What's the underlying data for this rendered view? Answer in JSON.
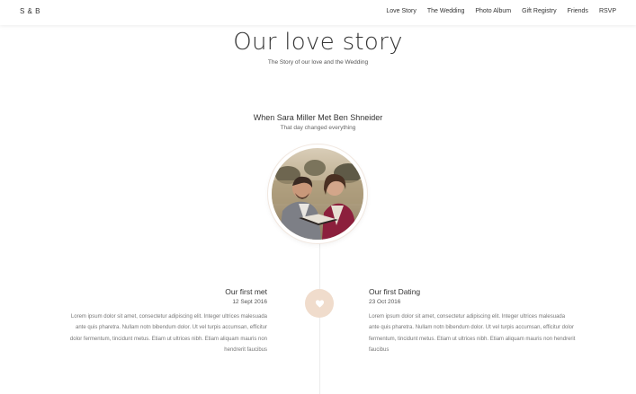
{
  "nav": {
    "brand": "S & B",
    "items": [
      "Love Story",
      "The Wedding",
      "Photo Album",
      "Gift Registry",
      "Friends",
      "RSVP"
    ]
  },
  "header": {
    "title": "Our love story",
    "subtitle": "The Story of our love and the Wedding"
  },
  "intro": {
    "heading": "When Sara Miller Met Ben Shneider",
    "subheading": "That day changed everything"
  },
  "timeline": {
    "badge_icon": "heart-icon",
    "events": [
      {
        "title": "Our first met",
        "date": "12 Sept 2016",
        "text": "Lorem ipsum dolor sit amet, consectetur adipiscing elit. Integer ultrices malesuada ante quis pharetra. Nullam notn bibendum dolor. Ut vel turpis accumsan, efficitur dolor fermentum, tincidunt metus. Etiam ut ultrices nibh. Etiam aliquam mauris non hendrerit faucibus"
      },
      {
        "title": "Our first Dating",
        "date": "23 Oct 2016",
        "text": "Lorem ipsum dolor sit amet, consectetur adipiscing elit. Integer ultrices malesuada ante quis pharetra. Nullam notn bibendum dolor. Ut vel turpis accumsan, efficitur dolor fermentum, tincidunt metus. Etiam ut ultrices nibh. Etiam aliquam mauris non hendrerit faucibus"
      }
    ]
  },
  "colors": {
    "accent_badge": "#f0dccc",
    "heart": "#ffffff"
  }
}
